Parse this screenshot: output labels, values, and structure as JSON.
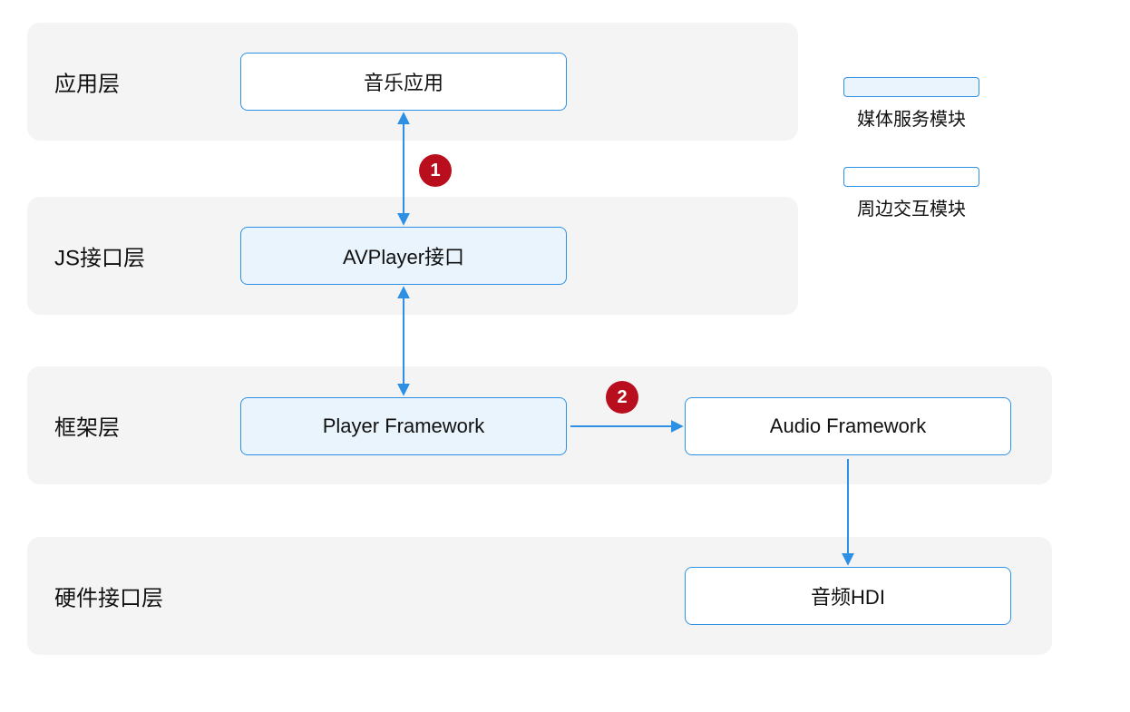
{
  "layers": {
    "app": {
      "title": "应用层"
    },
    "js": {
      "title": "JS接口层"
    },
    "fw": {
      "title": "框架层"
    },
    "hw": {
      "title": "硬件接口层"
    }
  },
  "boxes": {
    "music": {
      "label": "音乐应用"
    },
    "avplayer": {
      "label": "AVPlayer接口"
    },
    "playerfw": {
      "label": "Player Framework"
    },
    "audiofw": {
      "label": "Audio Framework"
    },
    "audiohdi": {
      "label": "音频HDI"
    }
  },
  "badges": {
    "b1": "1",
    "b2": "2"
  },
  "legend": {
    "media_module": "媒体服务模块",
    "peripheral_module": "周边交互模块"
  },
  "colors": {
    "border": "#2e90e5",
    "fill": "#eaf4fc",
    "badge": "#b90e1d",
    "layer_bg": "#f4f4f4"
  }
}
